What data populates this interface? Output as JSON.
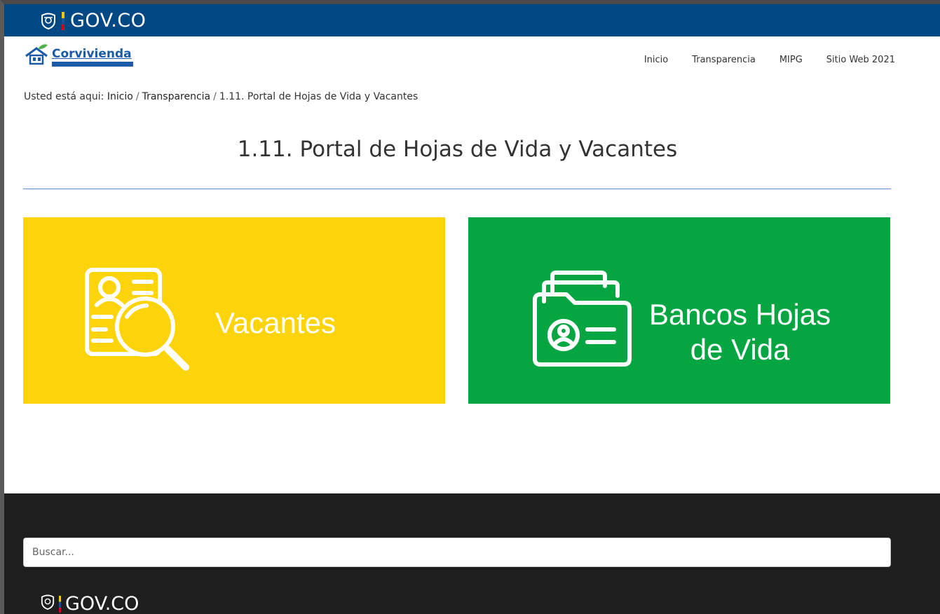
{
  "gov_bar": {
    "logo_text": "GOV.CO"
  },
  "header": {
    "brand_name": "Corvivienda",
    "nav": [
      "Inicio",
      "Transparencia",
      "MIPG",
      "Sitio Web 2021"
    ]
  },
  "breadcrumb": {
    "prefix": "Usted está aqui:",
    "items": [
      "Inicio",
      "Transparencia",
      "1.11. Portal de Hojas de Vida y Vacantes"
    ]
  },
  "page": {
    "title": "1.11. Portal de Hojas de Vida y Vacantes"
  },
  "cards": [
    {
      "label": "Vacantes",
      "color": "#fdd30a",
      "icon": "candidate-search-icon"
    },
    {
      "label_line1": "Bancos Hojas",
      "label_line2": "de Vida",
      "color": "#05a542",
      "icon": "resume-folder-icon"
    }
  ],
  "footer": {
    "search_placeholder": "Buscar...",
    "logo_text": "GOV.CO"
  },
  "colors": {
    "gov_blue": "#004884",
    "footer_bg": "#1e1e1e",
    "rule": "#5b8fd6"
  }
}
